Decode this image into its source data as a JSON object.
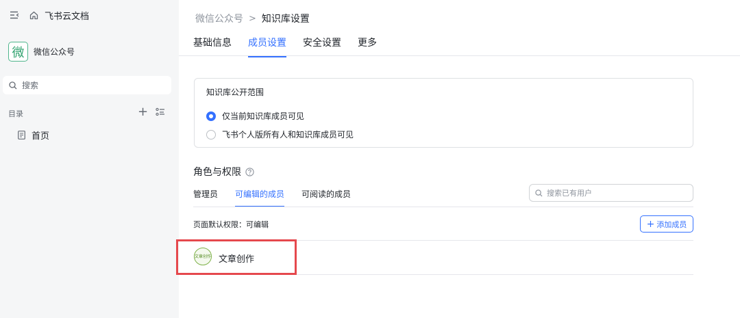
{
  "sidebar": {
    "app_title": "飞书云文档",
    "workspace_logo_char": "微",
    "workspace_name": "微信公众号",
    "search_placeholder": "搜索",
    "toc_label": "目录",
    "nav_items": [
      {
        "label": "首页",
        "icon": "document-icon"
      }
    ]
  },
  "breadcrumb": {
    "parent": "微信公众号",
    "separator": ">",
    "current": "知识库设置"
  },
  "tabs": [
    {
      "label": "基础信息",
      "active": false
    },
    {
      "label": "成员设置",
      "active": true
    },
    {
      "label": "安全设置",
      "active": false
    },
    {
      "label": "更多",
      "active": false
    }
  ],
  "visibility": {
    "title": "知识库公开范围",
    "options": [
      {
        "label": "仅当前知识库成员可见",
        "checked": true
      },
      {
        "label": "飞书个人版所有人和知识库成员可见",
        "checked": false
      }
    ]
  },
  "roles": {
    "title": "角色与权限",
    "subtabs": [
      {
        "label": "管理员",
        "active": false
      },
      {
        "label": "可编辑的成员",
        "active": true
      },
      {
        "label": "可阅读的成员",
        "active": false
      }
    ],
    "search_placeholder": "搜索已有用户",
    "default_permission": "页面默认权限：可编辑",
    "add_button": "添加成员",
    "members": [
      {
        "avatar_text": "文章创作",
        "name": "文章创作"
      }
    ]
  },
  "colors": {
    "accent": "#3370ff",
    "highlight": "#e5484d",
    "sidebar_bg": "#f5f6f7"
  }
}
